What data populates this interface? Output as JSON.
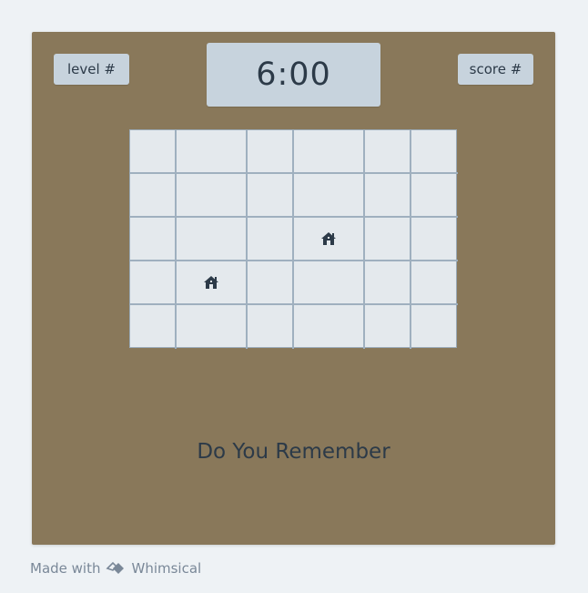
{
  "hud": {
    "level_label": "level #",
    "timer": "6:00",
    "score_label": "score #"
  },
  "grid": {
    "rows": 5,
    "cols": 6,
    "icons": [
      {
        "row": 2,
        "col": 3,
        "icon": "house-icon"
      },
      {
        "row": 3,
        "col": 1,
        "icon": "house-icon"
      }
    ]
  },
  "message": "Do You Remember",
  "footer": {
    "made_with": "Made with",
    "brand": "Whimsical"
  },
  "colors": {
    "background": "#eef2f5",
    "board": "#89785a",
    "pill": "#c7d3dd",
    "grid_cell": "#e4e9ed",
    "grid_line": "#9fb0bf",
    "text_dark": "#2c3a48"
  }
}
